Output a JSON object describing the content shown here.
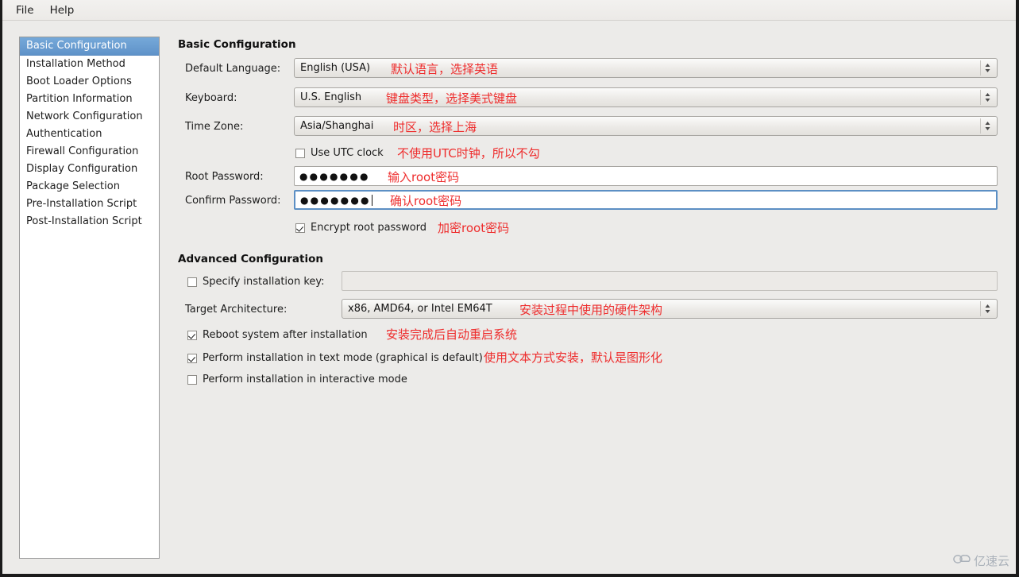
{
  "window": {
    "menubar": [
      {
        "label": "File"
      },
      {
        "label": "Help"
      }
    ]
  },
  "sidebar": {
    "items": [
      {
        "label": "Basic Configuration",
        "selected": true
      },
      {
        "label": "Installation Method",
        "selected": false
      },
      {
        "label": "Boot Loader Options",
        "selected": false
      },
      {
        "label": "Partition Information",
        "selected": false
      },
      {
        "label": "Network Configuration",
        "selected": false
      },
      {
        "label": "Authentication",
        "selected": false
      },
      {
        "label": "Firewall Configuration",
        "selected": false
      },
      {
        "label": "Display Configuration",
        "selected": false
      },
      {
        "label": "Package Selection",
        "selected": false
      },
      {
        "label": "Pre-Installation Script",
        "selected": false
      },
      {
        "label": "Post-Installation Script",
        "selected": false
      }
    ]
  },
  "basic": {
    "title": "Basic Configuration",
    "language_label": "Default Language:",
    "language_value": "English (USA)",
    "language_note": "默认语言，选择英语",
    "keyboard_label": "Keyboard:",
    "keyboard_value": "U.S. English",
    "keyboard_note": "键盘类型，选择美式键盘",
    "timezone_label": "Time Zone:",
    "timezone_value": "Asia/Shanghai",
    "timezone_note": "时区，选择上海",
    "utc_label": "Use UTC clock",
    "utc_checked": false,
    "utc_note": "不使用UTC时钟，所以不勾",
    "root_password_label": "Root Password:",
    "root_password_value": "●●●●●●●",
    "root_password_note": "输入root密码",
    "confirm_password_label": "Confirm Password:",
    "confirm_password_value": "●●●●●●●",
    "confirm_password_note": "确认root密码",
    "encrypt_label": "Encrypt root password",
    "encrypt_checked": true,
    "encrypt_note": "加密root密码"
  },
  "advanced": {
    "title": "Advanced Configuration",
    "install_key_label": "Specify installation key:",
    "install_key_checked": false,
    "install_key_value": "",
    "arch_label": "Target Architecture:",
    "arch_value": "x86, AMD64, or Intel EM64T",
    "arch_note": "安装过程中使用的硬件架构",
    "reboot_label": "Reboot system after installation",
    "reboot_checked": true,
    "reboot_note": "安装完成后自动重启系统",
    "textmode_label": "Perform installation in text mode (graphical is default)",
    "textmode_checked": true,
    "textmode_note": "使用文本方式安装，默认是图形化",
    "interactive_label": "Perform installation in interactive mode",
    "interactive_checked": false
  },
  "watermark": {
    "text": "亿速云"
  }
}
